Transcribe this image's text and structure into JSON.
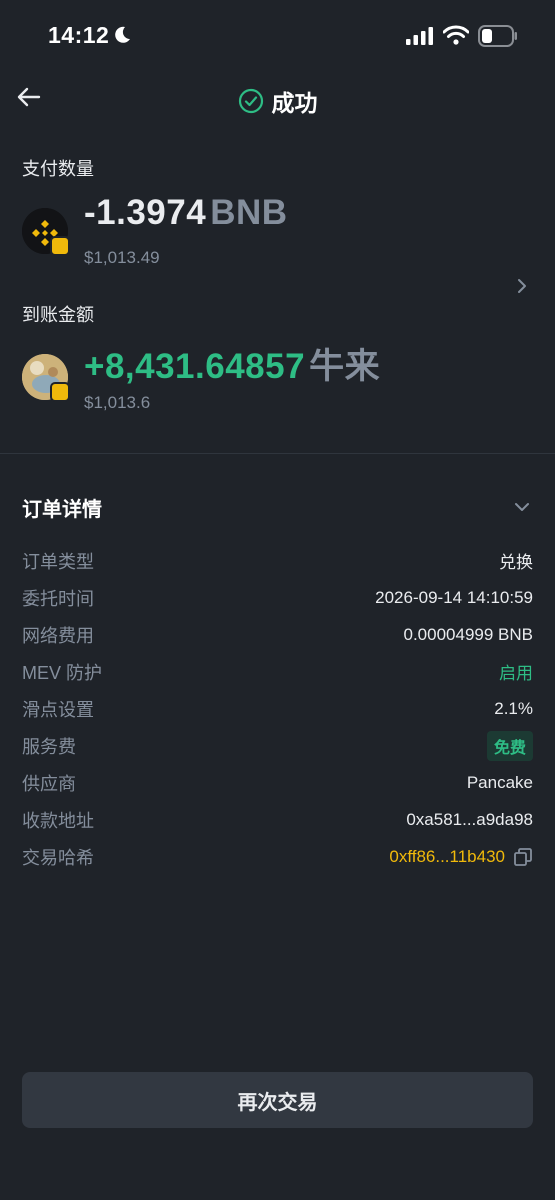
{
  "status_bar": {
    "time": "14:12"
  },
  "nav": {
    "title": "成功"
  },
  "pay": {
    "label": "支付数量",
    "amount": "-1.3974",
    "symbol": "BNB",
    "usd": "$1,013.49"
  },
  "receive": {
    "label": "到账金额",
    "amount": "+8,431.64857",
    "symbol": "牛来",
    "usd": "$1,013.6"
  },
  "details": {
    "title": "订单详情",
    "rows": [
      {
        "key": "订单类型",
        "value": "兑换"
      },
      {
        "key": "委托时间",
        "value": "2026-09-14 14:10:59"
      },
      {
        "key": "网络费用",
        "value": "0.00004999 BNB"
      },
      {
        "key": "MEV 防护",
        "value": "启用"
      },
      {
        "key": "滑点设置",
        "value": "2.1%"
      },
      {
        "key": "服务费",
        "value": "免费"
      },
      {
        "key": "供应商",
        "value": "Pancake"
      },
      {
        "key": "收款地址",
        "value": "0xa581...a9da98"
      },
      {
        "key": "交易哈希",
        "value": "0xff86...11b430"
      }
    ]
  },
  "cta": {
    "label": "再次交易"
  },
  "colors": {
    "background": "#1f2329",
    "success_green": "#2ebd85",
    "brand_yellow": "#f0b90b",
    "muted_text": "#848e9c"
  },
  "icons": [
    "moon-icon",
    "signal-icon",
    "wifi-icon",
    "battery-icon",
    "back-arrow-icon",
    "success-check-icon",
    "bnb-coin-icon",
    "token-coin-icon",
    "chevron-right-icon",
    "chevron-down-icon",
    "copy-icon"
  ]
}
